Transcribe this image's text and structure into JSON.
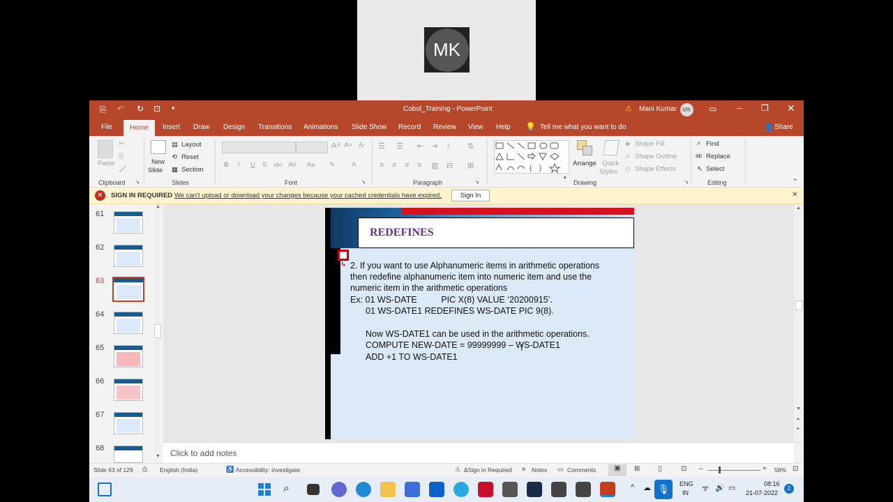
{
  "participant": {
    "initials": "MK"
  },
  "window": {
    "title": "Cobol_Training - PowerPoint",
    "user_name": "Mani Kumar",
    "user_initials": "MK"
  },
  "tabs": [
    "File",
    "Home",
    "Insert",
    "Draw",
    "Design",
    "Transitions",
    "Animations",
    "Slide Show",
    "Record",
    "Review",
    "View",
    "Help"
  ],
  "tell_me": "Tell me what you want to do",
  "share": "Share",
  "ribbon": {
    "clipboard": {
      "label": "Clipboard",
      "paste": "Paste"
    },
    "slides": {
      "label": "Slides",
      "new_slide": "New",
      "new_slide2": "Slide",
      "layout": "Layout",
      "reset": "Reset",
      "section": "Section"
    },
    "font": {
      "label": "Font",
      "bold": "B",
      "italic": "I",
      "underline": "U",
      "strike": "S",
      "abc": "abc",
      "av": "AV",
      "aa": "Aa",
      "a": "A"
    },
    "paragraph": {
      "label": "Paragraph"
    },
    "drawing": {
      "label": "Drawing",
      "arrange": "Arrange",
      "quick_styles": "Quick",
      "quick_styles2": "Styles",
      "shape_fill": "Shape Fill",
      "shape_outline": "Shape Outline",
      "shape_effects": "Shape Effects"
    },
    "editing": {
      "label": "Editing",
      "find": "Find",
      "replace": "Replace",
      "select": "Select"
    }
  },
  "signin_bar": {
    "title": "SIGN IN REQUIRED",
    "message": "We can't upload or download your changes because your cached credentials have expired.",
    "button": "Sign In"
  },
  "thumbnails": [
    {
      "num": "61"
    },
    {
      "num": "62"
    },
    {
      "num": "63",
      "selected": true
    },
    {
      "num": "64"
    },
    {
      "num": "65"
    },
    {
      "num": "66"
    },
    {
      "num": "67"
    },
    {
      "num": "68"
    }
  ],
  "slide": {
    "title": "REDEFINES",
    "lines": [
      "2. If you want to use Alphanumeric items in arithmetic operations",
      "then redefine alphanumeric item into numeric item and use the",
      "numeric item in the arithmetic operations",
      "Ex: 01 WS-DATE          PIC X(8) VALUE ‘20200915’.",
      "01 WS-DATE1 REDEFINES WS-DATE PIC 9(8).",
      "Now WS-DATE1 can be used in the arithmetic operations.",
      "COMPUTE NEW-DATE = 99999999 – WS-DATE1",
      "ADD +1 TO WS-DATE1"
    ]
  },
  "notes_placeholder": "Click to add notes",
  "status": {
    "slide_info": "Slide 63 of 129",
    "language": "English (India)",
    "accessibility": "Accessibility: Investigate",
    "signin_required": "&Sign in Required",
    "notes": "Notes",
    "comments": "Comments",
    "zoom": "58%"
  },
  "taskbar": {
    "lang1": "ENG",
    "lang2": "IN",
    "time": "08:16",
    "date": "21-07-2022",
    "notif_count": "2"
  },
  "colors": {
    "accent": "#b7472a",
    "slide_title": "#6b2e8a",
    "signin_bg": "#fff4ce"
  }
}
